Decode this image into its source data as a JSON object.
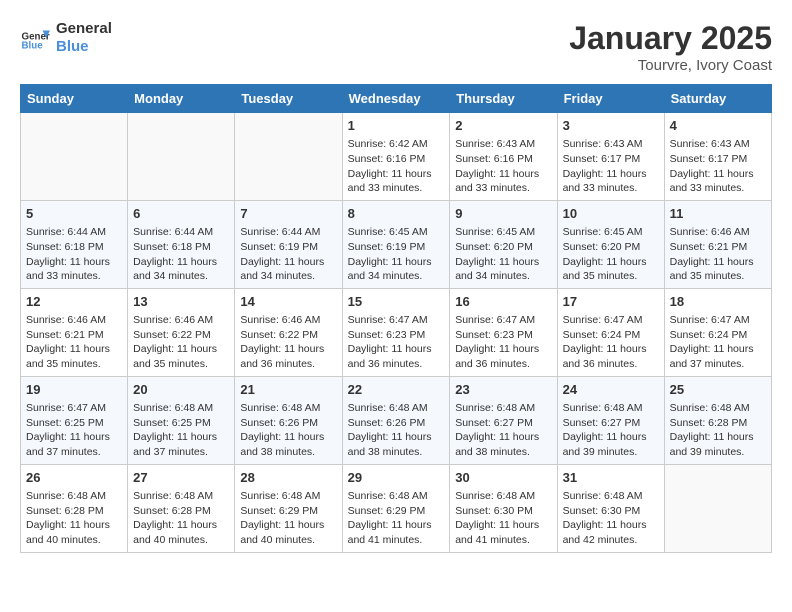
{
  "header": {
    "logo_line1": "General",
    "logo_line2": "Blue",
    "month": "January 2025",
    "location": "Tourvre, Ivory Coast"
  },
  "days_of_week": [
    "Sunday",
    "Monday",
    "Tuesday",
    "Wednesday",
    "Thursday",
    "Friday",
    "Saturday"
  ],
  "weeks": [
    [
      {
        "day": "",
        "info": ""
      },
      {
        "day": "",
        "info": ""
      },
      {
        "day": "",
        "info": ""
      },
      {
        "day": "1",
        "info": "Sunrise: 6:42 AM\nSunset: 6:16 PM\nDaylight: 11 hours\nand 33 minutes."
      },
      {
        "day": "2",
        "info": "Sunrise: 6:43 AM\nSunset: 6:16 PM\nDaylight: 11 hours\nand 33 minutes."
      },
      {
        "day": "3",
        "info": "Sunrise: 6:43 AM\nSunset: 6:17 PM\nDaylight: 11 hours\nand 33 minutes."
      },
      {
        "day": "4",
        "info": "Sunrise: 6:43 AM\nSunset: 6:17 PM\nDaylight: 11 hours\nand 33 minutes."
      }
    ],
    [
      {
        "day": "5",
        "info": "Sunrise: 6:44 AM\nSunset: 6:18 PM\nDaylight: 11 hours\nand 33 minutes."
      },
      {
        "day": "6",
        "info": "Sunrise: 6:44 AM\nSunset: 6:18 PM\nDaylight: 11 hours\nand 34 minutes."
      },
      {
        "day": "7",
        "info": "Sunrise: 6:44 AM\nSunset: 6:19 PM\nDaylight: 11 hours\nand 34 minutes."
      },
      {
        "day": "8",
        "info": "Sunrise: 6:45 AM\nSunset: 6:19 PM\nDaylight: 11 hours\nand 34 minutes."
      },
      {
        "day": "9",
        "info": "Sunrise: 6:45 AM\nSunset: 6:20 PM\nDaylight: 11 hours\nand 34 minutes."
      },
      {
        "day": "10",
        "info": "Sunrise: 6:45 AM\nSunset: 6:20 PM\nDaylight: 11 hours\nand 35 minutes."
      },
      {
        "day": "11",
        "info": "Sunrise: 6:46 AM\nSunset: 6:21 PM\nDaylight: 11 hours\nand 35 minutes."
      }
    ],
    [
      {
        "day": "12",
        "info": "Sunrise: 6:46 AM\nSunset: 6:21 PM\nDaylight: 11 hours\nand 35 minutes."
      },
      {
        "day": "13",
        "info": "Sunrise: 6:46 AM\nSunset: 6:22 PM\nDaylight: 11 hours\nand 35 minutes."
      },
      {
        "day": "14",
        "info": "Sunrise: 6:46 AM\nSunset: 6:22 PM\nDaylight: 11 hours\nand 36 minutes."
      },
      {
        "day": "15",
        "info": "Sunrise: 6:47 AM\nSunset: 6:23 PM\nDaylight: 11 hours\nand 36 minutes."
      },
      {
        "day": "16",
        "info": "Sunrise: 6:47 AM\nSunset: 6:23 PM\nDaylight: 11 hours\nand 36 minutes."
      },
      {
        "day": "17",
        "info": "Sunrise: 6:47 AM\nSunset: 6:24 PM\nDaylight: 11 hours\nand 36 minutes."
      },
      {
        "day": "18",
        "info": "Sunrise: 6:47 AM\nSunset: 6:24 PM\nDaylight: 11 hours\nand 37 minutes."
      }
    ],
    [
      {
        "day": "19",
        "info": "Sunrise: 6:47 AM\nSunset: 6:25 PM\nDaylight: 11 hours\nand 37 minutes."
      },
      {
        "day": "20",
        "info": "Sunrise: 6:48 AM\nSunset: 6:25 PM\nDaylight: 11 hours\nand 37 minutes."
      },
      {
        "day": "21",
        "info": "Sunrise: 6:48 AM\nSunset: 6:26 PM\nDaylight: 11 hours\nand 38 minutes."
      },
      {
        "day": "22",
        "info": "Sunrise: 6:48 AM\nSunset: 6:26 PM\nDaylight: 11 hours\nand 38 minutes."
      },
      {
        "day": "23",
        "info": "Sunrise: 6:48 AM\nSunset: 6:27 PM\nDaylight: 11 hours\nand 38 minutes."
      },
      {
        "day": "24",
        "info": "Sunrise: 6:48 AM\nSunset: 6:27 PM\nDaylight: 11 hours\nand 39 minutes."
      },
      {
        "day": "25",
        "info": "Sunrise: 6:48 AM\nSunset: 6:28 PM\nDaylight: 11 hours\nand 39 minutes."
      }
    ],
    [
      {
        "day": "26",
        "info": "Sunrise: 6:48 AM\nSunset: 6:28 PM\nDaylight: 11 hours\nand 40 minutes."
      },
      {
        "day": "27",
        "info": "Sunrise: 6:48 AM\nSunset: 6:28 PM\nDaylight: 11 hours\nand 40 minutes."
      },
      {
        "day": "28",
        "info": "Sunrise: 6:48 AM\nSunset: 6:29 PM\nDaylight: 11 hours\nand 40 minutes."
      },
      {
        "day": "29",
        "info": "Sunrise: 6:48 AM\nSunset: 6:29 PM\nDaylight: 11 hours\nand 41 minutes."
      },
      {
        "day": "30",
        "info": "Sunrise: 6:48 AM\nSunset: 6:30 PM\nDaylight: 11 hours\nand 41 minutes."
      },
      {
        "day": "31",
        "info": "Sunrise: 6:48 AM\nSunset: 6:30 PM\nDaylight: 11 hours\nand 42 minutes."
      },
      {
        "day": "",
        "info": ""
      }
    ]
  ]
}
